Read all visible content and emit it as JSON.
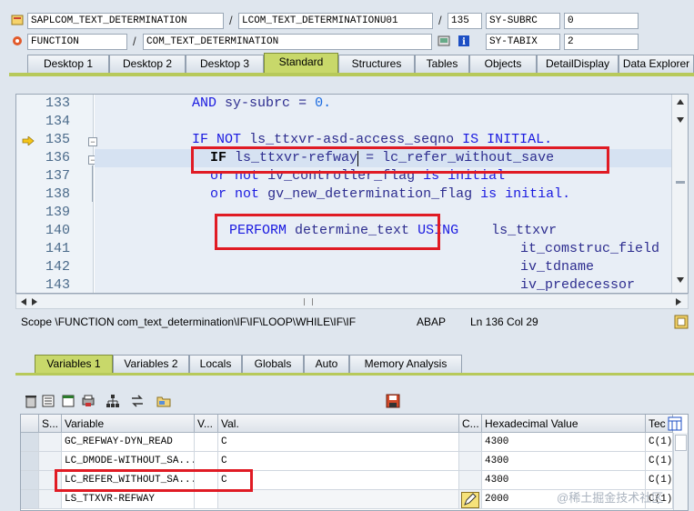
{
  "header": {
    "row1": {
      "program": "SAPLCOM_TEXT_DETERMINATION",
      "include": "LCOM_TEXT_DETERMINATIONU01",
      "line": "135",
      "sysvar": "SY-SUBRC",
      "sysval": "0"
    },
    "row2": {
      "type": "FUNCTION",
      "name": "COM_TEXT_DETERMINATION",
      "sysvar": "SY-TABIX",
      "sysval": "2"
    }
  },
  "tabs": [
    "Desktop 1",
    "Desktop 2",
    "Desktop 3",
    "Standard",
    "Structures",
    "Tables",
    "Objects",
    "DetailDisplay",
    "Data Explorer"
  ],
  "editor": {
    "lines": [
      {
        "no": "133",
        "code": "AND sy-subrc = 0."
      },
      {
        "no": "134",
        "code": ""
      },
      {
        "no": "135",
        "code": "IF NOT ls_ttxvr-asd-access_seqno IS INITIAL."
      },
      {
        "no": "136",
        "code": "IF ls_ttxvr-refway = lc_refer_without_save"
      },
      {
        "no": "137",
        "code": "or not iv_controller_flag is initial"
      },
      {
        "no": "138",
        "code": "or not gv_new_determination_flag is initial."
      },
      {
        "no": "139",
        "code": ""
      },
      {
        "no": "140",
        "code": "PERFORM determine_text USING    ls_ttxvr"
      },
      {
        "no": "141",
        "code": "it_comstruc_field"
      },
      {
        "no": "142",
        "code": "iv_tdname"
      },
      {
        "no": "143",
        "code": "iv_predecessor"
      }
    ]
  },
  "status": {
    "scope": "Scope \\FUNCTION com_text_determination\\IF\\IF\\LOOP\\WHILE\\IF\\IF",
    "lang": "ABAP",
    "pos": "Ln 136 Col  29"
  },
  "bottom_tabs": [
    "Variables 1",
    "Variables 2",
    "Locals",
    "Globals",
    "Auto",
    "Memory Analysis"
  ],
  "table": {
    "headers": [
      "S...",
      "Variable",
      "V...",
      "Val.",
      "C...",
      "Hexadecimal Value",
      "Tec"
    ],
    "rows": [
      {
        "variable": "GC_REFWAY-DYN_READ",
        "val": "C",
        "hex": "4300",
        "tec": "C(1)"
      },
      {
        "variable": "LC_DMODE-WITHOUT_SA...",
        "val": "C",
        "hex": "4300",
        "tec": "C(1)"
      },
      {
        "variable": "LC_REFER_WITHOUT_SA...",
        "val": "C",
        "hex": "4300",
        "tec": "C(1)"
      },
      {
        "variable": "LS_TTXVR-REFWAY",
        "val": "",
        "hex": "2000",
        "tec": "C(1)"
      }
    ]
  },
  "watermark": "@稀土掘金技术社区"
}
